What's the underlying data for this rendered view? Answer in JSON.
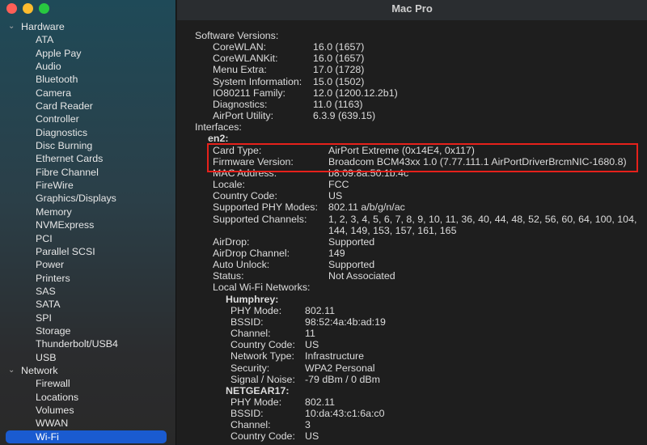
{
  "window": {
    "title": "Mac Pro"
  },
  "colors": {
    "accent": "#1a5bd0",
    "highlight_box": "#e6211b"
  },
  "sidebar": {
    "groups": [
      {
        "label": "Hardware",
        "items": [
          "ATA",
          "Apple Pay",
          "Audio",
          "Bluetooth",
          "Camera",
          "Card Reader",
          "Controller",
          "Diagnostics",
          "Disc Burning",
          "Ethernet Cards",
          "Fibre Channel",
          "FireWire",
          "Graphics/Displays",
          "Memory",
          "NVMExpress",
          "PCI",
          "Parallel SCSI",
          "Power",
          "Printers",
          "SAS",
          "SATA",
          "SPI",
          "Storage",
          "Thunderbolt/USB4",
          "USB"
        ]
      },
      {
        "label": "Network",
        "items": [
          "Firewall",
          "Locations",
          "Volumes",
          "WWAN",
          "Wi-Fi"
        ]
      }
    ],
    "selected": "Wi-Fi"
  },
  "content": {
    "rows": [
      {
        "l": "Software Versions:",
        "lv": 0
      },
      {
        "l": "CoreWLAN:",
        "v": "16.0 (1657)",
        "lv": 1
      },
      {
        "l": "CoreWLANKit:",
        "v": "16.0 (1657)",
        "lv": 1
      },
      {
        "l": "Menu Extra:",
        "v": "17.0 (1728)",
        "lv": 1
      },
      {
        "l": "System Information:",
        "v": "15.0 (1502)",
        "lv": 1
      },
      {
        "l": "IO80211 Family:",
        "v": "12.0 (1200.12.2b1)",
        "lv": 1
      },
      {
        "l": "Diagnostics:",
        "v": "11.0 (1163)",
        "lv": 1
      },
      {
        "l": "AirPort Utility:",
        "v": "6.3.9 (639.15)",
        "lv": 1
      },
      {
        "l": "Interfaces:",
        "lv": 0
      },
      {
        "l": "en2:",
        "lv": 2,
        "bold": true
      },
      {
        "l": "Card Type:",
        "v": "AirPort Extreme  (0x14E4, 0x117)",
        "lv": 3
      },
      {
        "l": "Firmware Version:",
        "v": "Broadcom BCM43xx 1.0 (7.77.111.1 AirPortDriverBrcmNIC-1680.8)",
        "lv": 3
      },
      {
        "l": "MAC Address:",
        "v": "b8:09:8a:50:1b:4c",
        "lv": 3
      },
      {
        "l": "Locale:",
        "v": "FCC",
        "lv": 3
      },
      {
        "l": "Country Code:",
        "v": "US",
        "lv": 3
      },
      {
        "l": "Supported PHY Modes:",
        "v": "802.11 a/b/g/n/ac",
        "lv": 3
      },
      {
        "l": "Supported Channels:",
        "v": "1, 2, 3, 4, 5, 6, 7, 8, 9, 10, 11, 36, 40, 44, 48, 52, 56, 60, 64, 100, 104,",
        "lv": 3
      },
      {
        "l": "",
        "v": "144, 149, 153, 157, 161, 165",
        "lv": 3
      },
      {
        "l": "AirDrop:",
        "v": "Supported",
        "lv": 3
      },
      {
        "l": "AirDrop Channel:",
        "v": "149",
        "lv": 3
      },
      {
        "l": "Auto Unlock:",
        "v": "Supported",
        "lv": 3
      },
      {
        "l": "Status:",
        "v": "Not Associated",
        "lv": 3
      },
      {
        "l": "Local Wi-Fi Networks:",
        "lv": 3
      },
      {
        "l": "Humphrey:",
        "lv": 4,
        "bold": true
      },
      {
        "l": "PHY Mode:",
        "v": "802.11",
        "lv": 5
      },
      {
        "l": "BSSID:",
        "v": "98:52:4a:4b:ad:19",
        "lv": 5
      },
      {
        "l": "Channel:",
        "v": "11",
        "lv": 5
      },
      {
        "l": "Country Code:",
        "v": "US",
        "lv": 5
      },
      {
        "l": "Network Type:",
        "v": "Infrastructure",
        "lv": 5
      },
      {
        "l": "Security:",
        "v": "WPA2 Personal",
        "lv": 5
      },
      {
        "l": "Signal / Noise:",
        "v": "-79 dBm / 0 dBm",
        "lv": 5
      },
      {
        "l": "NETGEAR17:",
        "lv": 4,
        "bold": true
      },
      {
        "l": "PHY Mode:",
        "v": "802.11",
        "lv": 5
      },
      {
        "l": "BSSID:",
        "v": "10:da:43:c1:6a:c0",
        "lv": 5
      },
      {
        "l": "Channel:",
        "v": "3",
        "lv": 5
      },
      {
        "l": "Country Code:",
        "v": "US",
        "lv": 5
      }
    ]
  }
}
